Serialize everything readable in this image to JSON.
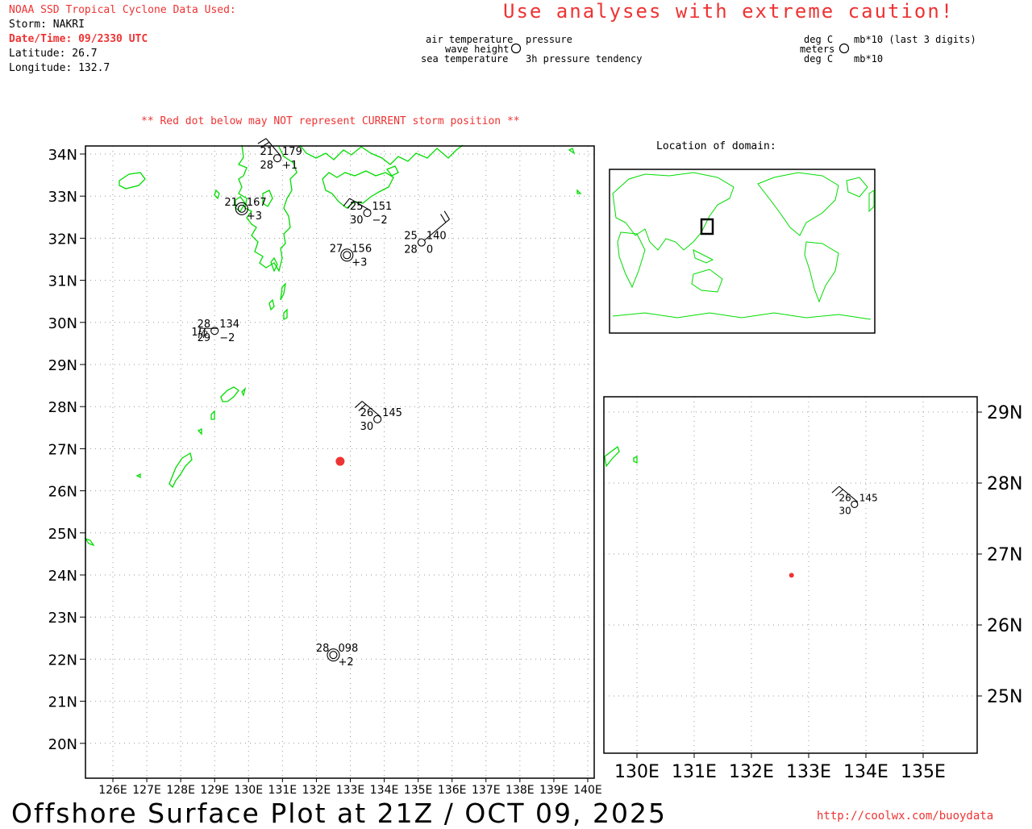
{
  "header": {
    "source_title": "NOAA SSD Tropical Cyclone Data Used:",
    "storm": "Storm: NAKRI",
    "datetime": "Date/Time: 09/2330 UTC",
    "latitude": "Latitude: 26.7",
    "longitude": "Longitude: 132.7",
    "caution": "Use analyses with extreme caution!"
  },
  "legend": {
    "left_top": "air temperature",
    "left_mid": "wave height",
    "left_bot": "sea temperature",
    "right_top": "pressure",
    "right_bot": "3h pressure tendency",
    "unit_left_top": "deg C",
    "unit_left_mid": "meters",
    "unit_left_bot": "deg C",
    "unit_right_top": "mb*10 (last 3 digits)",
    "unit_right_bot": "mb*10"
  },
  "red_dot_note": "** Red dot below may NOT represent CURRENT storm position **",
  "inset_title": "Location of domain:",
  "footer": {
    "title": "Offshore Surface Plot at 21Z / OCT 09, 2025",
    "url": "http://coolwx.com/buoydata"
  },
  "colors": {
    "coast": "#00dd00",
    "storm": "#ee3333",
    "text_red": "#ee3333",
    "grid": "#999999"
  },
  "storm": {
    "lat": 26.7,
    "lon": 132.7
  },
  "main_map": {
    "lat_labels": [
      "34N",
      "33N",
      "32N",
      "31N",
      "30N",
      "29N",
      "28N",
      "27N",
      "26N",
      "25N",
      "24N",
      "23N",
      "22N",
      "21N",
      "20N"
    ],
    "lon_labels": [
      "126E",
      "127E",
      "128E",
      "129E",
      "130E",
      "131E",
      "132E",
      "133E",
      "134E",
      "135E",
      "136E",
      "137E",
      "138E",
      "139E",
      "140E"
    ]
  },
  "zoom_map": {
    "lat_labels": [
      "29N",
      "28N",
      "27N",
      "26N",
      "25N"
    ],
    "lon_labels": [
      "130E",
      "131E",
      "132E",
      "133E",
      "134E",
      "135E"
    ]
  },
  "stations": [
    {
      "id": "s1",
      "lat": 33.9,
      "lon": 130.85,
      "air": "21",
      "pres": "179",
      "sea": "28",
      "tend": "+1",
      "wave": ""
    },
    {
      "id": "s2",
      "lat": 32.7,
      "lon": 129.8,
      "air": "21",
      "pres": "167",
      "sea": "",
      "tend": "+3",
      "wave": ""
    },
    {
      "id": "s3",
      "lat": 32.6,
      "lon": 133.5,
      "air": "25",
      "pres": "151",
      "sea": "30",
      "tend": "−2",
      "wave": ""
    },
    {
      "id": "s4",
      "lat": 31.9,
      "lon": 135.1,
      "air": "25",
      "pres": "140",
      "sea": "28",
      "tend": "0",
      "wave": ""
    },
    {
      "id": "s5",
      "lat": 31.6,
      "lon": 132.9,
      "air": "27",
      "pres": "156",
      "sea": "",
      "tend": "+3",
      "wave": ""
    },
    {
      "id": "s6",
      "lat": 29.8,
      "lon": 129.0,
      "air": "28",
      "pres": "134",
      "sea": "29",
      "tend": "−2",
      "wave": "1½"
    },
    {
      "id": "s7",
      "lat": 27.7,
      "lon": 133.8,
      "air": "26",
      "pres": "145",
      "sea": "30",
      "tend": "",
      "wave": ""
    },
    {
      "id": "s8",
      "lat": 22.1,
      "lon": 132.5,
      "air": "28",
      "pres": "098",
      "sea": "",
      "tend": "+2",
      "wave": ""
    }
  ],
  "zoom_stations": [
    {
      "id": "z1",
      "lat": 27.7,
      "lon": 133.8,
      "air": "26",
      "pres": "145",
      "sea": "30"
    }
  ]
}
